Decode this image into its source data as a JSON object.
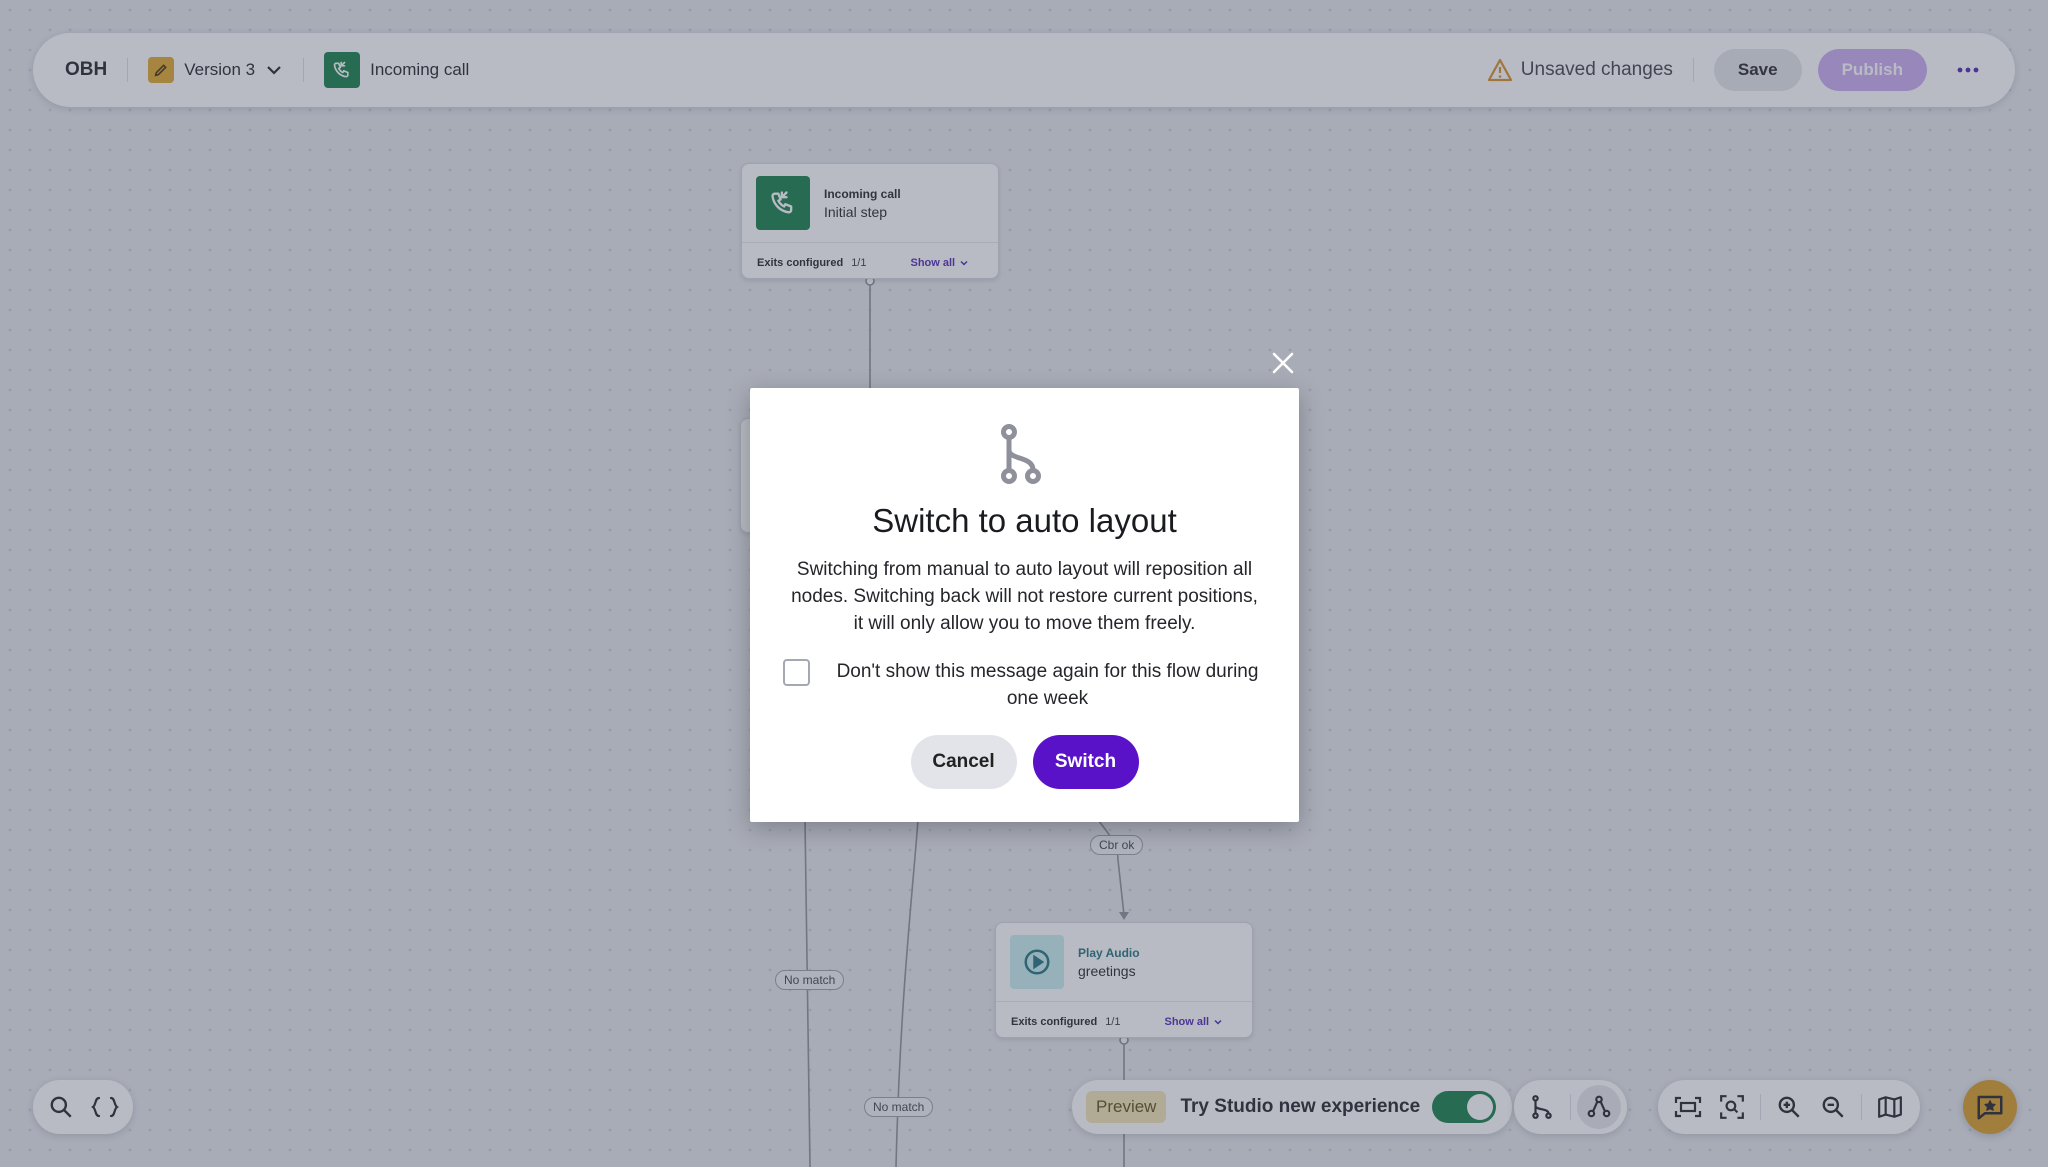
{
  "topbar": {
    "brand": "OBH",
    "version_label": "Version 3",
    "flow_name": "Incoming call",
    "unsaved_text": "Unsaved changes",
    "save_label": "Save",
    "publish_label": "Publish"
  },
  "nodes": {
    "incoming": {
      "type": "Incoming call",
      "name": "Initial step",
      "exits_label": "Exits configured",
      "exits_count": "1/1",
      "show_all": "Show all"
    },
    "play_audio": {
      "type": "Play Audio",
      "name": "greetings",
      "exits_label": "Exits configured",
      "exits_count": "1/1",
      "show_all": "Show all"
    }
  },
  "edge_labels": {
    "cbr_ok": "Cbr ok",
    "no_match_1": "No match",
    "no_match_2": "No match"
  },
  "bottom": {
    "preview_tag": "Preview",
    "try_text": "Try Studio new experience",
    "toggle_on": true
  },
  "modal": {
    "title": "Switch to auto layout",
    "body": "Switching from manual to auto layout will reposition all nodes. Switching back will not restore current positions, it will only allow you to move them freely.",
    "checkbox_label": "Don't show this message again for this flow during one week",
    "cancel_label": "Cancel",
    "switch_label": "Switch"
  },
  "colors": {
    "accent": "#5a12c9",
    "publish_disabled": "#c9a8f2",
    "incoming_green": "#0e7a44",
    "version_badge": "#e0a526",
    "warning": "#d98a1e",
    "chat_fab": "#d99a1e"
  },
  "icons": {
    "version": "pencil-icon",
    "flow": "phone-incoming-icon",
    "warning": "warning-icon",
    "more": "more-horizontal-icon",
    "modal": "branch-icon",
    "close": "close-icon"
  }
}
